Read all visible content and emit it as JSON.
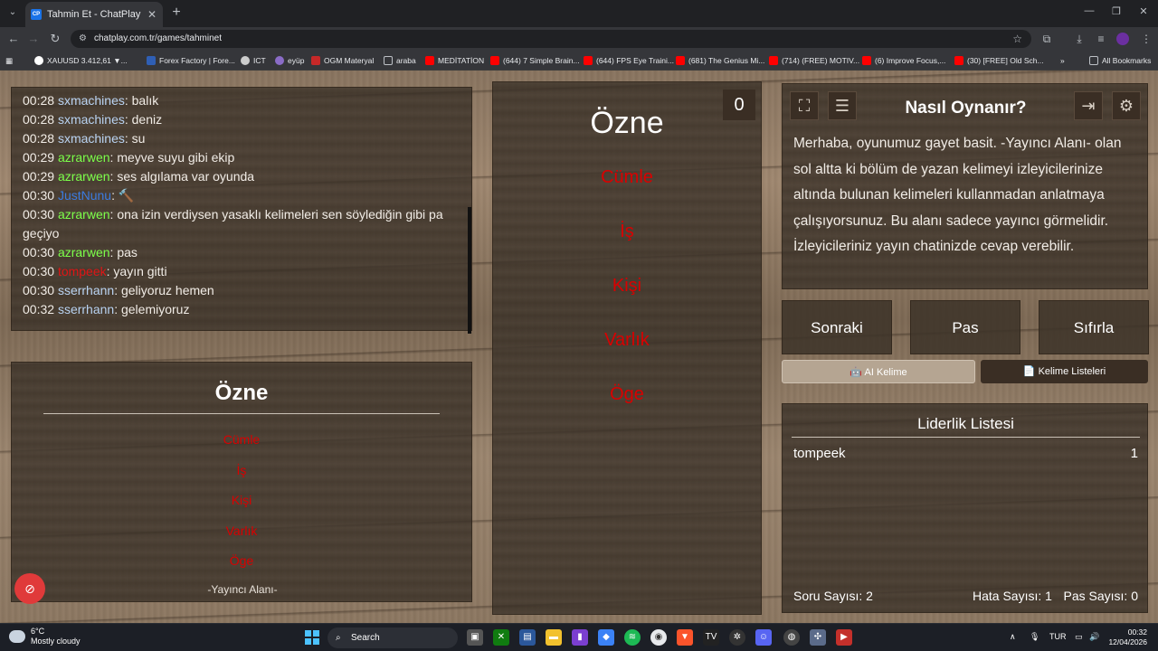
{
  "browser": {
    "tab_title": "Tahmin Et - ChatPlay",
    "tab_favicon": "CP",
    "url": "chatplay.com.tr/games/tahminet",
    "bookmarks": [
      {
        "label": "XAUUSD 3.412,61 ▼..."
      },
      {
        "label": "Forex Factory | Fore..."
      },
      {
        "label": "ICT"
      },
      {
        "label": "eyüp"
      },
      {
        "label": "OGM Materyal"
      },
      {
        "label": "araba"
      },
      {
        "label": "MEDİTATİON"
      },
      {
        "label": "(644) 7 Simple Brain..."
      },
      {
        "label": "(644) FPS Eye Traini..."
      },
      {
        "label": "(681) The Genius Mi..."
      },
      {
        "label": "(714) (FREE) MOTIV..."
      },
      {
        "label": "(6) Improve Focus,..."
      },
      {
        "label": "(30) [FREE] Old Sch..."
      }
    ],
    "all_bookmarks": "All Bookmarks",
    "overflow": "»"
  },
  "chat": {
    "messages": [
      {
        "time": "00:28",
        "user": "sxmachines",
        "color": "#b9d3f2",
        "text": "balık"
      },
      {
        "time": "00:28",
        "user": "sxmachines",
        "color": "#b9d3f2",
        "text": "deniz"
      },
      {
        "time": "00:28",
        "user": "sxmachines",
        "color": "#b9d3f2",
        "text": "su"
      },
      {
        "time": "00:29",
        "user": "azrarwen",
        "color": "#7cff4a",
        "text": "meyve suyu gibi ekip"
      },
      {
        "time": "00:29",
        "user": "azrarwen",
        "color": "#7cff4a",
        "text": "ses algılama var oyunda"
      },
      {
        "time": "00:30",
        "user": "JustNunu",
        "color": "#3b7be0",
        "text": "🔨"
      },
      {
        "time": "00:30",
        "user": "azrarwen",
        "color": "#7cff4a",
        "text": "ona izin verdiysen yasaklı kelimeleri sen söylediğin gibi pa geçiyo"
      },
      {
        "time": "00:30",
        "user": "azrarwen",
        "color": "#7cff4a",
        "text": "pas"
      },
      {
        "time": "00:30",
        "user": "tompeek",
        "color": "#e01515",
        "text": "yayın gitti"
      },
      {
        "time": "00:30",
        "user": "sserrhann",
        "color": "#b9d3f2",
        "text": "geliyoruz hemen"
      },
      {
        "time": "00:32",
        "user": "sserrhann",
        "color": "#b9d3f2",
        "text": "gelemiyoruz"
      }
    ]
  },
  "caller": {
    "word": "Özne",
    "forbidden": [
      "Cümle",
      "İş",
      "Kişi",
      "Varlık",
      "Öge"
    ],
    "tag": "-Yayıncı Alanı-"
  },
  "center": {
    "word": "Özne",
    "forbidden": [
      "Cümle",
      "İş",
      "Kişi",
      "Varlık",
      "Öge"
    ],
    "score": "0"
  },
  "how_to": {
    "title": "Nasıl Oynanır?",
    "text": "Merhaba, oyunumuz gayet basit. -Yayıncı Alanı- olan sol altta ki bölüm de yazan kelimeyi izleyicilerinize altında bulunan kelimeleri kullanmadan anlatmaya çalışıyorsunuz. Bu alanı sadece yayıncı görmelidir. İzleyicileriniz yayın chatinizde cevap verebilir."
  },
  "actions": {
    "next": "Sonraki",
    "pass": "Pas",
    "reset": "Sıfırla"
  },
  "tabs": {
    "ai_word": "AI Kelime",
    "word_lists": "Kelime Listeleri"
  },
  "leaderboard": {
    "title": "Liderlik Listesi",
    "entries": [
      {
        "name": "tompeek",
        "score": "1"
      }
    ],
    "question_count": "Soru Sayısı: 2",
    "error_count": "Hata Sayısı: 1",
    "pass_count": "Pas Sayısı: 0"
  },
  "taskbar": {
    "temp": "6°C",
    "weather": "Mostly cloudy",
    "search": "Search",
    "lang": "TUR",
    "time": "00:32",
    "date": "12/04/2026"
  }
}
